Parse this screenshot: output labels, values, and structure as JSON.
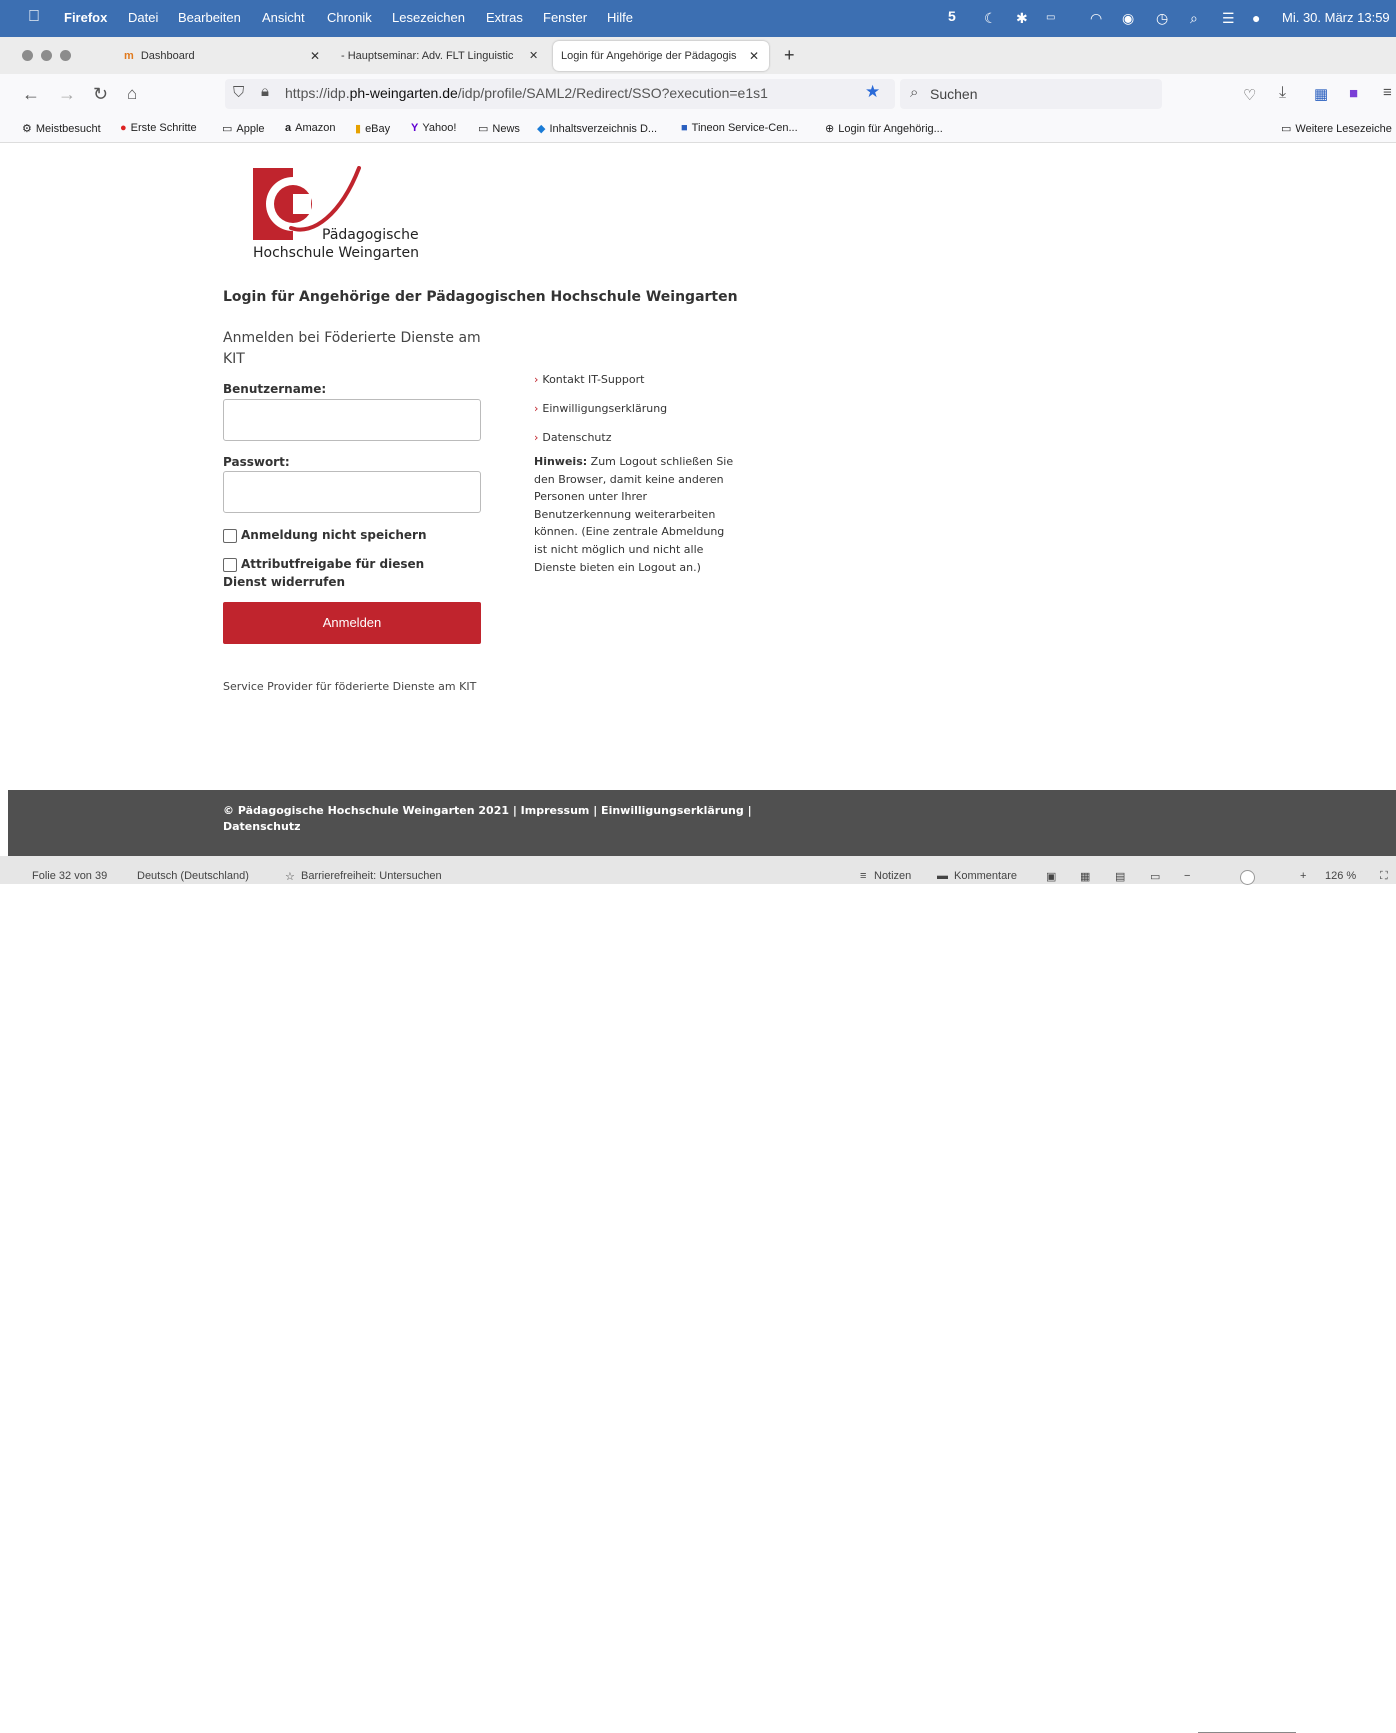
{
  "menubar": {
    "app": "Firefox",
    "items": [
      "Datei",
      "Bearbeiten",
      "Ansicht",
      "Chronik",
      "Lesezeichen",
      "Extras",
      "Fenster",
      "Hilfe"
    ],
    "clock": "Mi. 30. März  13:59"
  },
  "tabs": [
    {
      "label": "Dashboard",
      "active": false
    },
    {
      "label": "- Hauptseminar: Adv. FLT Linguistic",
      "active": false
    },
    {
      "label": "Login für Angehörige der Pädagogis",
      "active": true
    }
  ],
  "urlbar": {
    "prefix": "https://idp.",
    "domain": "ph-weingarten.de",
    "path": "/idp/profile/SAML2/Redirect/SSO?execution=e1s1"
  },
  "search": {
    "placeholder": "Suchen"
  },
  "bookmarks": [
    "Meistbesucht",
    "Erste Schritte",
    "Apple",
    "Amazon",
    "eBay",
    "Yahoo!",
    "News",
    "Inhaltsverzeichnis D...",
    "Tineon Service-Cen...",
    "Login für Angehörig...",
    "Weitere Lesezeiche"
  ],
  "logo": {
    "line1": "Pädagogische",
    "line2": "Hochschule Weingarten"
  },
  "page": {
    "heading": "Login für Angehörige der Pädagogischen Hochschule Weingarten",
    "sp_name": "Anmelden bei Föderierte Dienste am KIT",
    "username_label": "Benutzername:",
    "password_label": "Passwort:",
    "checkbox1": "Anmeldung nicht speichern",
    "checkbox2": "Attributfreigabe für diesen Dienst widerrufen",
    "login_button": "Anmelden",
    "sp_footer": "Service Provider für föderierte Dienste am KIT",
    "side_links": [
      "Kontakt IT-Support",
      "Einwilligungserklärung",
      "Datenschutz"
    ],
    "hint_label": "Hinweis:",
    "hint_text": " Zum Logout schließen Sie den Browser, damit keine anderen Personen unter Ihrer Benutzerkennung weiterarbeiten können. (Eine zentrale Abmeldung ist nicht möglich und nicht alle Dienste bieten ein Logout an.)"
  },
  "footer": {
    "text": "© Pädagogische Hochschule Weingarten 2021 | Impressum | Einwilligungserklärung | Datenschutz"
  },
  "statusbar": {
    "slide": "Folie 32 von 39",
    "language": "Deutsch (Deutschland)",
    "accessibility": "Barrierefreiheit: Untersuchen",
    "notes": "Notizen",
    "comments": "Kommentare",
    "zoom": "126 %"
  },
  "colors": {
    "brand_red": "#c0242d",
    "menubar_blue": "#3c6fb2",
    "footer_gray": "#505050"
  }
}
